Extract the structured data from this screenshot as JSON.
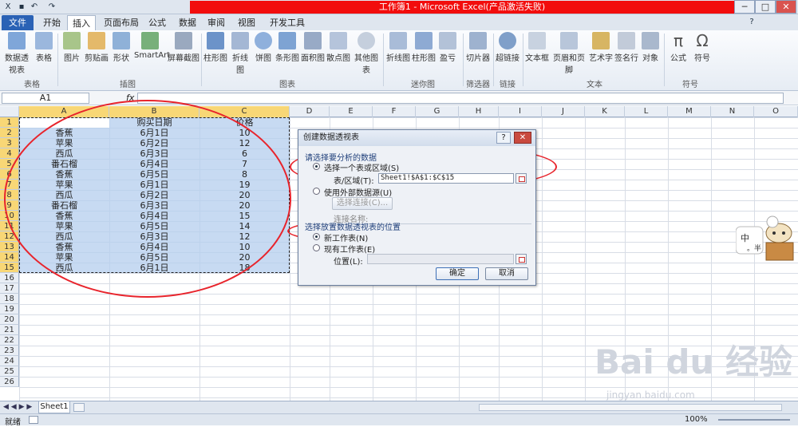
{
  "window": {
    "title": "工作簿1 - Microsoft Excel(产品激活失败)",
    "controls": [
      "─",
      "□",
      "✕"
    ]
  },
  "ribbon_tabs": [
    "文件",
    "开始",
    "插入",
    "页面布局",
    "公式",
    "数据",
    "审阅",
    "视图",
    "开发工具"
  ],
  "ribbon": {
    "buttons": [
      "数据透视表",
      "表格",
      "图片",
      "剪贴画",
      "形状",
      "SmartArt",
      "屏幕截图",
      "柱形图",
      "折线图",
      "饼图",
      "条形图",
      "面积图",
      "散点图",
      "其他图表",
      "折线图",
      "柱形图",
      "盈亏",
      "切片器",
      "超链接",
      "文本框",
      "页眉和页脚",
      "艺术字",
      "签名行",
      "对象",
      "公式",
      "符号"
    ],
    "groups": [
      "表格",
      "插图",
      "图表",
      "迷你图",
      "筛选器",
      "链接",
      "文本",
      "符号"
    ],
    "symbol_glyphs": [
      "π",
      "Ω"
    ],
    "colors": {
      "file_tab": "#2a62b5",
      "title_highlight": "#f20d0d",
      "selection": "#b4ceee",
      "header_selected": "#f8d776",
      "annotation": "#e8242c"
    }
  },
  "formula_bar": {
    "name_box": "A1",
    "fx": "fx",
    "formula": ""
  },
  "columns": [
    "A",
    "B",
    "C",
    "D",
    "E",
    "F",
    "G",
    "H",
    "I",
    "J",
    "K",
    "L",
    "M",
    "N",
    "O"
  ],
  "rows": [
    "1",
    "2",
    "3",
    "4",
    "5",
    "6",
    "7",
    "8",
    "9",
    "10",
    "11",
    "12",
    "13",
    "14",
    "15",
    "16",
    "17",
    "18",
    "19",
    "20",
    "21",
    "22",
    "23",
    "24",
    "25",
    "26"
  ],
  "table": {
    "headers": [
      "",
      "购买日期",
      "价格"
    ],
    "rows": [
      [
        "香蕉",
        "6月1日",
        "10"
      ],
      [
        "苹果",
        "6月2日",
        "12"
      ],
      [
        "西瓜",
        "6月3日",
        "6"
      ],
      [
        "番石榴",
        "6月4日",
        "7"
      ],
      [
        "香蕉",
        "6月5日",
        "8"
      ],
      [
        "苹果",
        "6月1日",
        "19"
      ],
      [
        "西瓜",
        "6月2日",
        "20"
      ],
      [
        "番石榴",
        "6月3日",
        "20"
      ],
      [
        "香蕉",
        "6月4日",
        "15"
      ],
      [
        "苹果",
        "6月5日",
        "14"
      ],
      [
        "西瓜",
        "6月3日",
        "12"
      ],
      [
        "香蕉",
        "6月4日",
        "10"
      ],
      [
        "苹果",
        "6月5日",
        "20"
      ],
      [
        "西瓜",
        "6月1日",
        "18"
      ]
    ]
  },
  "dialog": {
    "title": "创建数据透视表",
    "help": "?",
    "close": "✕",
    "section1": "请选择要分析的数据",
    "option_table": "选择一个表或区域(S)",
    "range_label": "表/区域(T):",
    "range_value": "Sheet1!$A$1:$C$15",
    "option_external": "使用外部数据源(U)",
    "choose_connection": "选择连接(C)...",
    "connection_name": "连接名称:",
    "section2": "选择放置数据透视表的位置",
    "option_new": "新工作表(N)",
    "option_existing": "现有工作表(E)",
    "location_label": "位置(L):",
    "ok": "确定",
    "cancel": "取消"
  },
  "sheet_tabs": {
    "nav": "◀ ◀ ▶ ▶",
    "active": "Sheet1"
  },
  "status": {
    "text": "就绪",
    "zoom": "100%"
  },
  "watermark": {
    "logo": "Bai du 经验",
    "url": "jingyan.baidu.com"
  }
}
